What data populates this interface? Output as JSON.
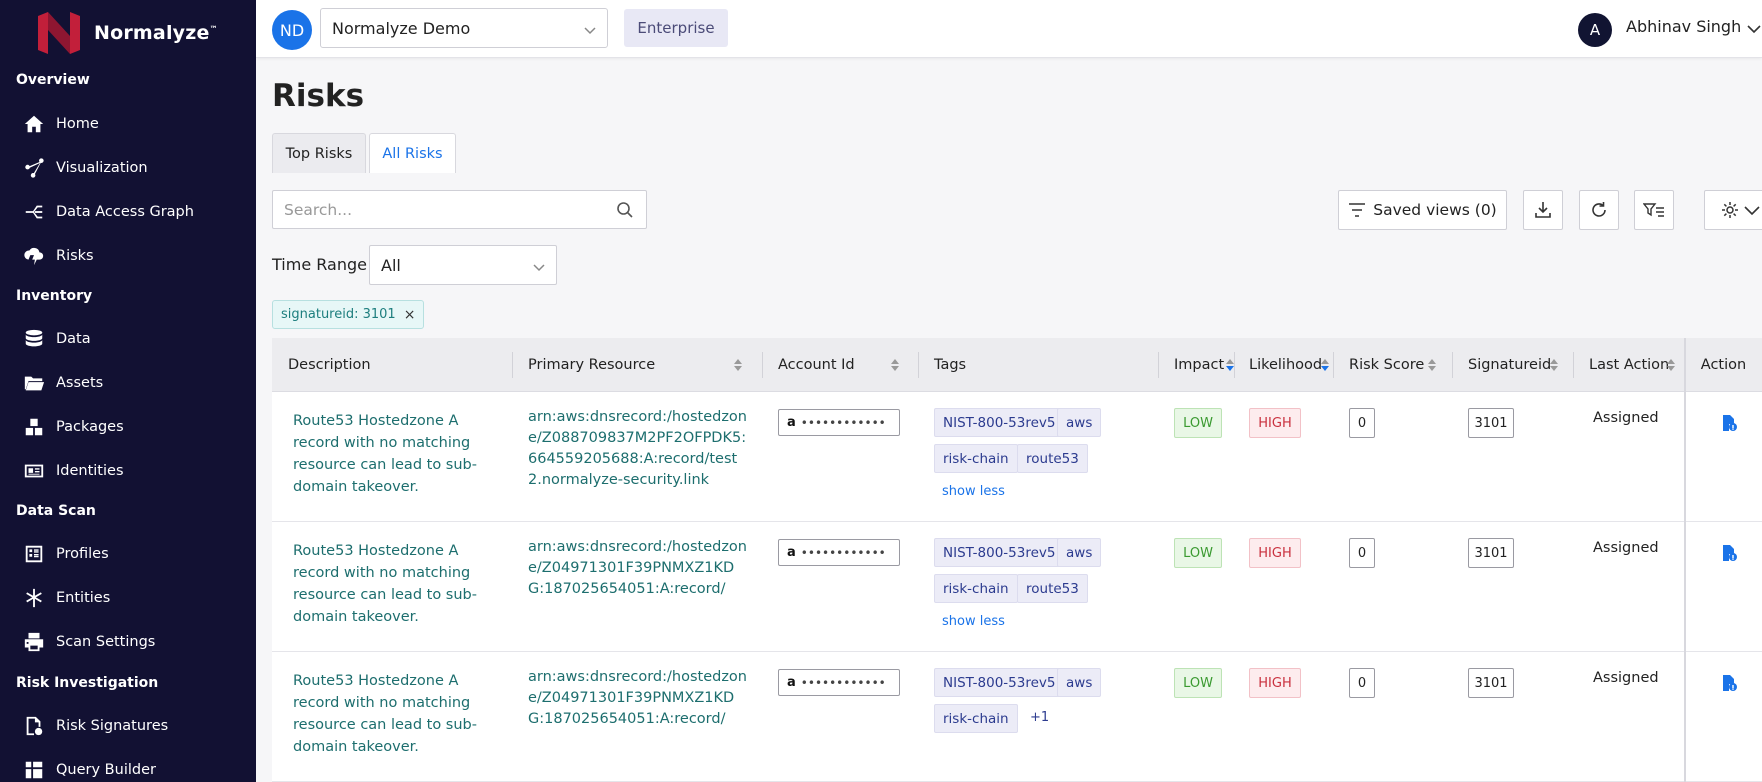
{
  "app": {
    "name": "Normalyze",
    "trademark": "™"
  },
  "sidebar": {
    "sections": [
      {
        "label": "Overview",
        "items": [
          {
            "label": "Home",
            "icon": "home-icon"
          },
          {
            "label": "Visualization",
            "icon": "visualization-icon"
          },
          {
            "label": "Data Access Graph",
            "icon": "graph-icon"
          },
          {
            "label": "Risks",
            "icon": "risk-cloud-icon"
          }
        ]
      },
      {
        "label": "Inventory",
        "items": [
          {
            "label": "Data",
            "icon": "database-icon"
          },
          {
            "label": "Assets",
            "icon": "folder-icon"
          },
          {
            "label": "Packages",
            "icon": "packages-icon"
          },
          {
            "label": "Identities",
            "icon": "id-card-icon"
          }
        ]
      },
      {
        "label": "Data Scan",
        "items": [
          {
            "label": "Profiles",
            "icon": "profiles-icon"
          },
          {
            "label": "Entities",
            "icon": "asterisk-icon"
          },
          {
            "label": "Scan Settings",
            "icon": "printer-icon"
          }
        ]
      },
      {
        "label": "Risk Investigation",
        "items": [
          {
            "label": "Risk Signatures",
            "icon": "signature-file-icon"
          },
          {
            "label": "Query Builder",
            "icon": "query-builder-icon"
          }
        ]
      }
    ]
  },
  "header": {
    "org_initials": "ND",
    "org_name": "Normalyze Demo",
    "plan": "Enterprise",
    "user_initial": "A",
    "user_name": "Abhinav Singh"
  },
  "page": {
    "title": "Risks",
    "tabs": [
      "Top Risks",
      "All Risks"
    ],
    "active_tab": "All Risks",
    "search_placeholder": "Search...",
    "saved_views_label": "Saved views (0)",
    "time_range_label": "Time Range",
    "time_range_value": "All",
    "filter_chip": "signatureid: 3101",
    "filter_remove": "×"
  },
  "colors": {
    "sidebar_bg": "#121133",
    "link_teal": "#1d6e6e",
    "accent_blue": "#1a73e8",
    "low_green": "#3a9a30",
    "high_red": "#c9303e"
  },
  "table": {
    "columns": [
      "Description",
      "Primary Resource",
      "Account Id",
      "Tags",
      "Impact",
      "Likelihood",
      "Risk Score",
      "Signatureid",
      "Last Action",
      "Action"
    ],
    "rows": [
      {
        "description": "Route53 Hostedzone A record with no matching resource can lead to sub-domain takeover.",
        "resource": "arn:aws:dnsrecord:/hostedzone/Z088709837M2PF2OFPDK5:664559205688:A:record/test2.normalyze-security.link",
        "account_id": "••••••••••••",
        "tags": [
          "NIST-800-53rev5",
          "aws",
          "risk-chain",
          "route53"
        ],
        "tags_toggle": "show less",
        "impact": "LOW",
        "likelihood": "HIGH",
        "risk_score": "0",
        "signatureid": "3101",
        "last_action": "Assigned"
      },
      {
        "description": "Route53 Hostedzone A record with no matching resource can lead to sub-domain takeover.",
        "resource": "arn:aws:dnsrecord:/hostedzone/Z04971301F39PNMXZ1KDG:187025654051:A:record/",
        "account_id": "••••••••••••",
        "tags": [
          "NIST-800-53rev5",
          "aws",
          "risk-chain",
          "route53"
        ],
        "tags_toggle": "show less",
        "impact": "LOW",
        "likelihood": "HIGH",
        "risk_score": "0",
        "signatureid": "3101",
        "last_action": "Assigned"
      },
      {
        "description": "Route53 Hostedzone A record with no matching resource can lead to sub-domain takeover.",
        "resource": "arn:aws:dnsrecord:/hostedzone/Z04971301F39PNMXZ1KDG:187025654051:A:record/",
        "account_id": "••••••••••••",
        "tags": [
          "NIST-800-53rev5",
          "aws",
          "risk-chain"
        ],
        "tags_more": "+1",
        "impact": "LOW",
        "likelihood": "HIGH",
        "risk_score": "0",
        "signatureid": "3101",
        "last_action": "Assigned"
      }
    ]
  }
}
